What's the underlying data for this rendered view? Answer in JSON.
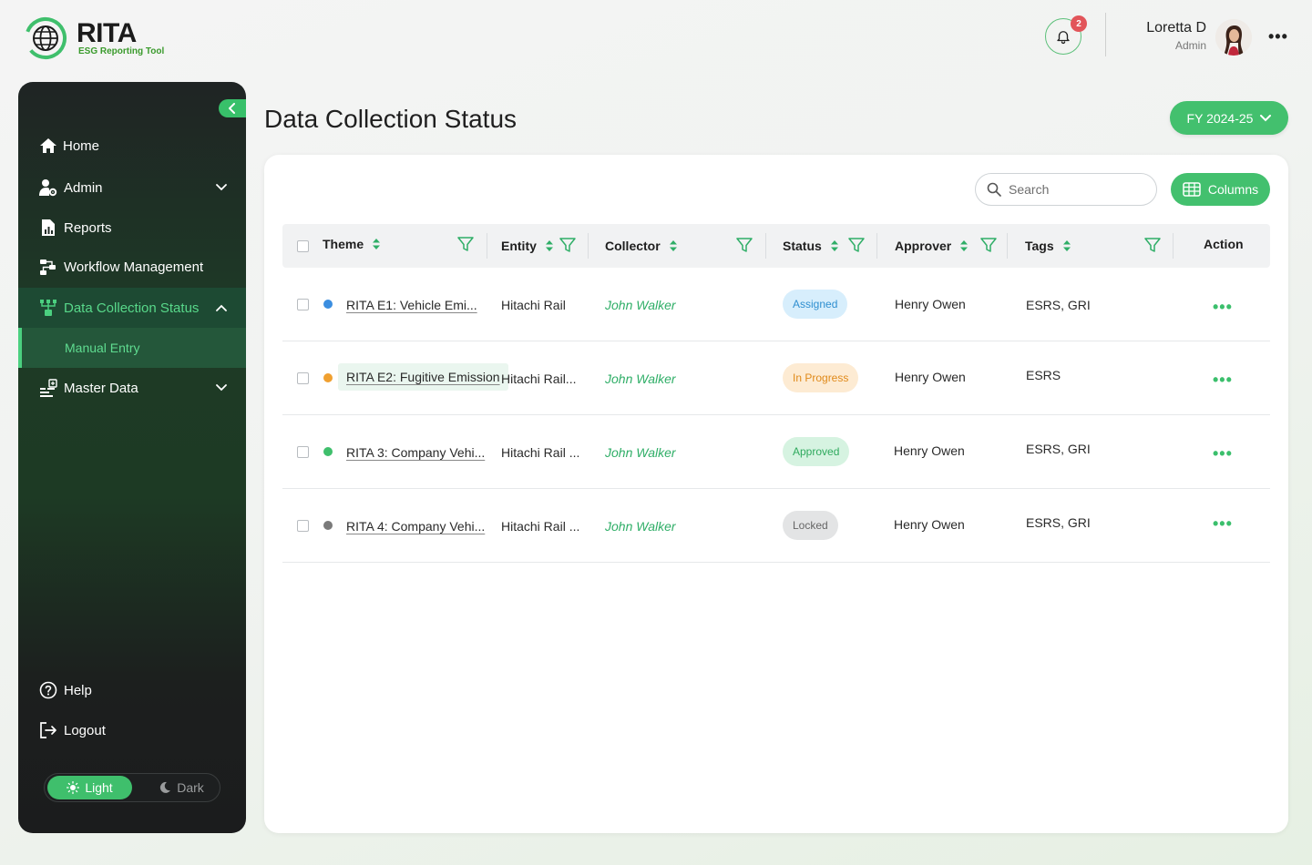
{
  "brand": {
    "name": "RITA",
    "tagline": "ESG Reporting Tool",
    "accent": "#43c06e"
  },
  "header": {
    "notification_count": "2",
    "user_name": "Loretta D",
    "user_role": "Admin",
    "more_label": "•••"
  },
  "sidebar": {
    "items": [
      {
        "label": "Home",
        "icon": "home-icon"
      },
      {
        "label": "Admin",
        "icon": "user-gear-icon",
        "expandable": true
      },
      {
        "label": "Reports",
        "icon": "report-icon"
      },
      {
        "label": "Workflow Management",
        "icon": "workflow-icon"
      },
      {
        "label": "Data Collection Status",
        "icon": "sitemap-icon",
        "expanded": true,
        "active": true
      },
      {
        "label": "Manual Entry",
        "icon": "",
        "sub": true,
        "active": true
      },
      {
        "label": "Master Data",
        "icon": "database-icon",
        "expandable": true
      }
    ],
    "bottom": [
      {
        "label": "Help",
        "icon": "help-icon"
      },
      {
        "label": "Logout",
        "icon": "logout-icon"
      }
    ],
    "theme_toggle": {
      "light": "Light",
      "dark": "Dark",
      "selected": "Light"
    }
  },
  "main": {
    "title": "Data Collection Status",
    "fiscal_year": "FY 2024-25",
    "search_placeholder": "Search",
    "columns_label": "Columns",
    "table": {
      "headers": [
        "Theme",
        "Entity",
        "Collector",
        "Status",
        "Approver",
        "Tags",
        "Action"
      ],
      "rows": [
        {
          "dot_color": "#3b8ee0",
          "theme": "RITA E1: Vehicle Emi...",
          "entity": "Hitachi Rail",
          "collector": "John Walker",
          "status": "Assigned",
          "approver": "Henry Owen",
          "tags": "ESRS, GRI",
          "action": "•••"
        },
        {
          "dot_color": "#f0a030",
          "theme": "RITA E2: Fugitive Emission",
          "entity": "Hitachi Rail...",
          "collector": "John Walker",
          "status": "In Progress",
          "approver": "Henry Owen",
          "tags": "ESRS",
          "action": "•••"
        },
        {
          "dot_color": "#3fbf6c",
          "theme": "RITA 3: Company Vehi...",
          "entity": "Hitachi Rail ...",
          "collector": "John Walker",
          "status": "Approved",
          "approver": "Henry Owen",
          "tags": "ESRS, GRI",
          "action": "•••"
        },
        {
          "dot_color": "#7a7a7a",
          "theme": "RITA 4: Company Vehi...",
          "entity": "Hitachi Rail ...",
          "collector": "John Walker",
          "status": "Locked",
          "approver": "Henry Owen",
          "tags": "ESRS, GRI",
          "action": "•••"
        }
      ],
      "status_colors": {
        "Assigned": {
          "bg": "#d7eefc",
          "fg": "#2f8fd0"
        },
        "In Progress": {
          "bg": "#fdebd3",
          "fg": "#e08a1a"
        },
        "Approved": {
          "bg": "#d6f3e1",
          "fg": "#2faa5e"
        },
        "Locked": {
          "bg": "#e3e4e5",
          "fg": "#666666"
        }
      }
    }
  }
}
